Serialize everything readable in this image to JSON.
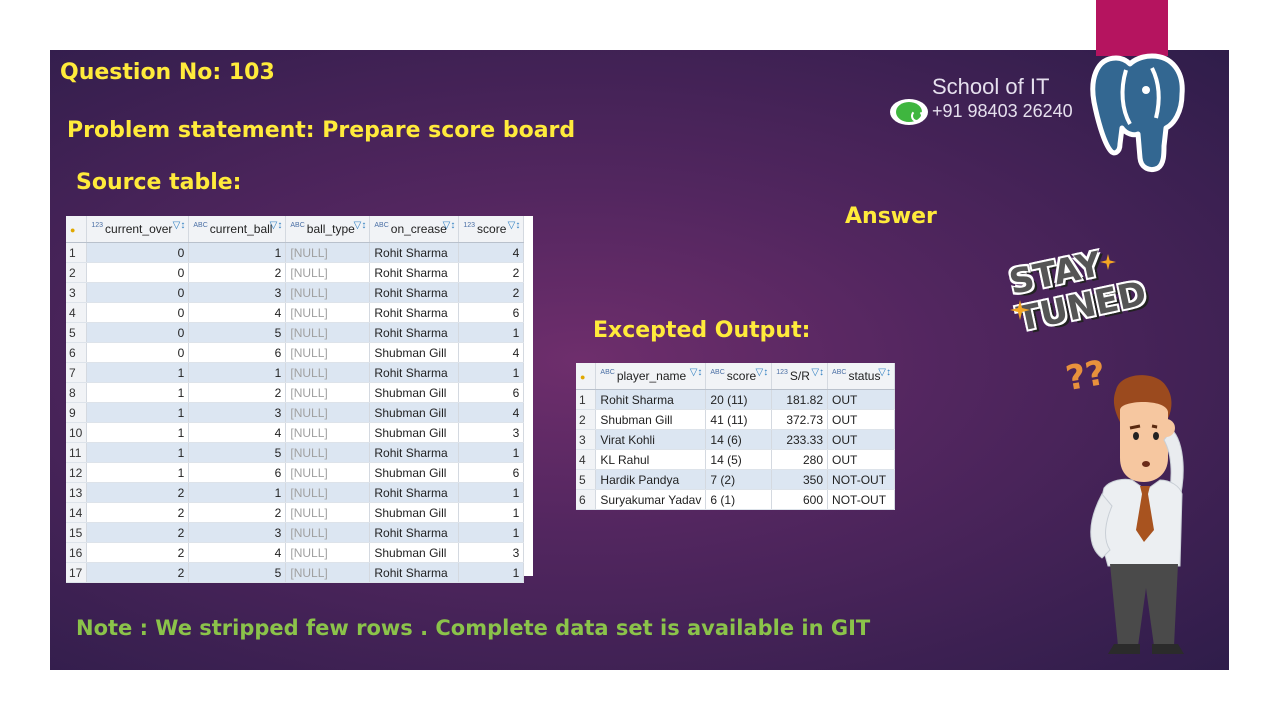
{
  "slide": {
    "question": "Question No: 103",
    "problem": "Problem statement: Prepare score board",
    "source_label": "Source table:",
    "answer_label": "Answer",
    "expected_label": "Excepted Output:",
    "note": "Note : We stripped few rows . Complete data set is available in GIT",
    "school": "School of IT",
    "phone": "+91 98403 26240",
    "stay_tuned": [
      "STAY",
      "TUNED"
    ],
    "question_marks": "??"
  },
  "source_table": {
    "columns": [
      {
        "type": "123",
        "name": "current_over"
      },
      {
        "type": "ABC",
        "name": "current_ball"
      },
      {
        "type": "ABC",
        "name": "ball_type"
      },
      {
        "type": "ABC",
        "name": "on_crease"
      },
      {
        "type": "123",
        "name": "score"
      }
    ],
    "rows": [
      [
        "1",
        "0",
        "1",
        "[NULL]",
        "Rohit Sharma",
        "4"
      ],
      [
        "2",
        "0",
        "2",
        "[NULL]",
        "Rohit Sharma",
        "2"
      ],
      [
        "3",
        "0",
        "3",
        "[NULL]",
        "Rohit Sharma",
        "2"
      ],
      [
        "4",
        "0",
        "4",
        "[NULL]",
        "Rohit Sharma",
        "6"
      ],
      [
        "5",
        "0",
        "5",
        "[NULL]",
        "Rohit Sharma",
        "1"
      ],
      [
        "6",
        "0",
        "6",
        "[NULL]",
        "Shubman Gill",
        "4"
      ],
      [
        "7",
        "1",
        "1",
        "[NULL]",
        "Rohit Sharma",
        "1"
      ],
      [
        "8",
        "1",
        "2",
        "[NULL]",
        "Shubman Gill",
        "6"
      ],
      [
        "9",
        "1",
        "3",
        "[NULL]",
        "Shubman Gill",
        "4"
      ],
      [
        "10",
        "1",
        "4",
        "[NULL]",
        "Shubman Gill",
        "3"
      ],
      [
        "11",
        "1",
        "5",
        "[NULL]",
        "Rohit Sharma",
        "1"
      ],
      [
        "12",
        "1",
        "6",
        "[NULL]",
        "Shubman Gill",
        "6"
      ],
      [
        "13",
        "2",
        "1",
        "[NULL]",
        "Rohit Sharma",
        "1"
      ],
      [
        "14",
        "2",
        "2",
        "[NULL]",
        "Shubman Gill",
        "1"
      ],
      [
        "15",
        "2",
        "3",
        "[NULL]",
        "Rohit Sharma",
        "1"
      ],
      [
        "16",
        "2",
        "4",
        "[NULL]",
        "Shubman Gill",
        "3"
      ],
      [
        "17",
        "2",
        "5",
        "[NULL]",
        "Rohit Sharma",
        "1"
      ]
    ]
  },
  "output_table": {
    "columns": [
      {
        "type": "ABC",
        "name": "player_name"
      },
      {
        "type": "ABC",
        "name": "score"
      },
      {
        "type": "123",
        "name": "S/R"
      },
      {
        "type": "ABC",
        "name": "status"
      }
    ],
    "rows": [
      [
        "1",
        "Rohit Sharma",
        "20 (11)",
        "181.82",
        "OUT"
      ],
      [
        "2",
        "Shubman Gill",
        "41 (11)",
        "372.73",
        "OUT"
      ],
      [
        "3",
        "Virat Kohli",
        "14 (6)",
        "233.33",
        "OUT"
      ],
      [
        "4",
        "KL Rahul",
        "14 (5)",
        "280",
        "OUT"
      ],
      [
        "5",
        "Hardik Pandya",
        "7 (2)",
        "350",
        "NOT-OUT"
      ],
      [
        "6",
        "Suryakumar Yadav",
        "6 (1)",
        "600",
        "NOT-OUT"
      ]
    ]
  },
  "colors": {
    "title": "#ffeb3b",
    "note": "#8bc34a",
    "accent_tab": "#b5145f"
  }
}
